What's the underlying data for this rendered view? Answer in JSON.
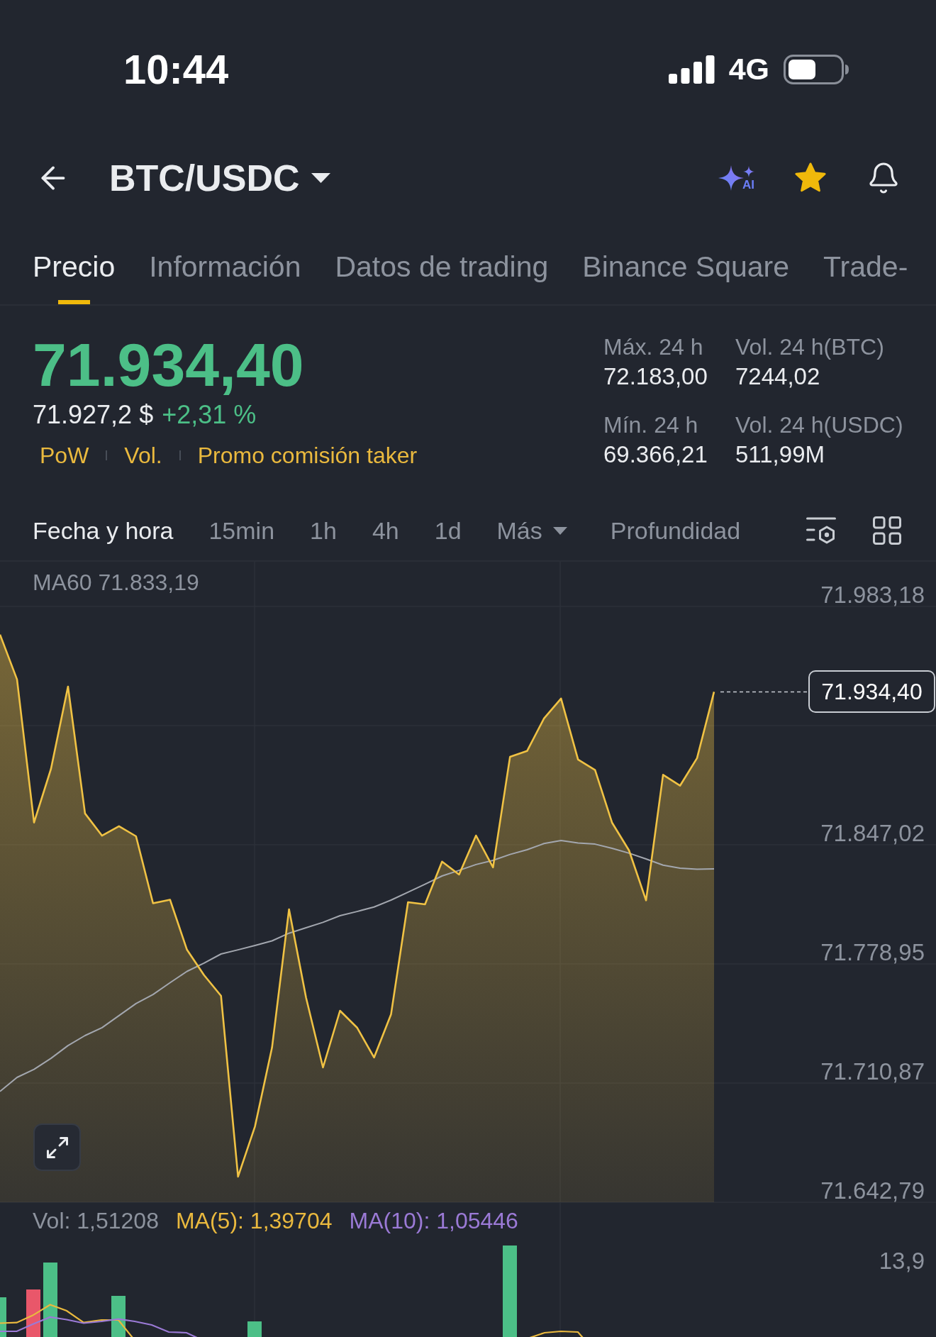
{
  "status_bar": {
    "time": "10:44",
    "network": "4G"
  },
  "header": {
    "pair": "BTC/USDC",
    "ai_label": "AI",
    "favorite": true
  },
  "tabs": [
    {
      "label": "Precio",
      "selected": true
    },
    {
      "label": "Información",
      "selected": false
    },
    {
      "label": "Datos de trading",
      "selected": false
    },
    {
      "label": "Binance Square",
      "selected": false
    },
    {
      "label": "Trade-",
      "selected": false
    }
  ],
  "price": {
    "last": "71.934,40",
    "rising": true,
    "fiat": "71.927,2 $",
    "change": "+2,31 %",
    "tags": [
      "PoW",
      "Vol.",
      "Promo comisión taker"
    ]
  },
  "stats": [
    {
      "label": "Máx. 24 h",
      "value": "72.183,00"
    },
    {
      "label": "Vol. 24 h(BTC)",
      "value": "7244,02"
    },
    {
      "label": "Mín. 24 h",
      "value": "69.366,21"
    },
    {
      "label": "Vol. 24 h(USDC)",
      "value": "511,99M"
    }
  ],
  "intervals": [
    {
      "label": "Fecha y hora",
      "kind": "option",
      "selected": true
    },
    {
      "label": "15min",
      "kind": "option",
      "selected": false
    },
    {
      "label": "1h",
      "kind": "option",
      "selected": false
    },
    {
      "label": "4h",
      "kind": "option",
      "selected": false
    },
    {
      "label": "1d",
      "kind": "option",
      "selected": false
    },
    {
      "label": "Más",
      "kind": "dropdown",
      "selected": false
    }
  ],
  "depth": {
    "label": "Profundidad",
    "selected": false
  },
  "chart": {
    "indicator": "MA60 71.833,19",
    "current_price": "71.934,40",
    "chart_data": {
      "type": "area",
      "grid": true,
      "ylim": [
        71642.79,
        72008.71
      ],
      "yticks": [
        {
          "value": 71983.18,
          "label": "71.983,18"
        },
        {
          "value": 71847.02,
          "label": "71.847,02"
        },
        {
          "value": 71778.95,
          "label": "71.778,95"
        },
        {
          "value": 71710.87,
          "label": "71.710,87"
        },
        {
          "value": 71642.79,
          "label": "71.642,79"
        }
      ],
      "series": [
        {
          "color": "#f0c244",
          "values": [
            71967.1,
            71941.5,
            71859.7,
            71890.4,
            71937.4,
            71864.9,
            71852.2,
            71857.6,
            71851.9,
            71813.6,
            71815.6,
            71787.0,
            71772.6,
            71760.7,
            71657.4,
            71686.1,
            71731.1,
            71810.1,
            71759.7,
            71719.8,
            71752.2,
            71742.6,
            71725.5,
            71750.2,
            71814.2,
            71813.0,
            71837.4,
            71830.0,
            71852.3,
            71834.1,
            71897.3,
            71900.6,
            71919.2,
            71930.6,
            71895.7,
            71889.7,
            71859.7,
            71843.8,
            71815.3,
            71887.0,
            71880.8,
            71896.5,
            71934.4
          ]
        },
        {
          "type": "line",
          "color": "#a3a7af",
          "values": [
            71706.1,
            71714.1,
            71718.7,
            71725.0,
            71732.3,
            71738.0,
            71742.5,
            71749.4,
            71756.3,
            71761.5,
            71768.2,
            71774.7,
            71779.4,
            71784.6,
            71787.0,
            71789.5,
            71792.1,
            71796.5,
            71799.6,
            71802.7,
            71806.5,
            71808.9,
            71811.5,
            71815.4,
            71819.9,
            71824.5,
            71829.2,
            71832.4,
            71835.7,
            71838.1,
            71841.5,
            71844.2,
            71847.7,
            71849.5,
            71848.0,
            71847.4,
            71845.0,
            71842.2,
            71838.9,
            71835.4,
            71833.7,
            71833.0,
            71833.2
          ]
        }
      ]
    }
  },
  "volume": {
    "readouts": [
      {
        "text": "Vol: 1,51208",
        "color": "#8d939e"
      },
      {
        "text": "MA(5): 1,39704",
        "color": "#eab93e"
      },
      {
        "text": "MA(10): 1,05446",
        "color": "#9b7ad6"
      }
    ],
    "axis_label": "13,9"
  }
}
